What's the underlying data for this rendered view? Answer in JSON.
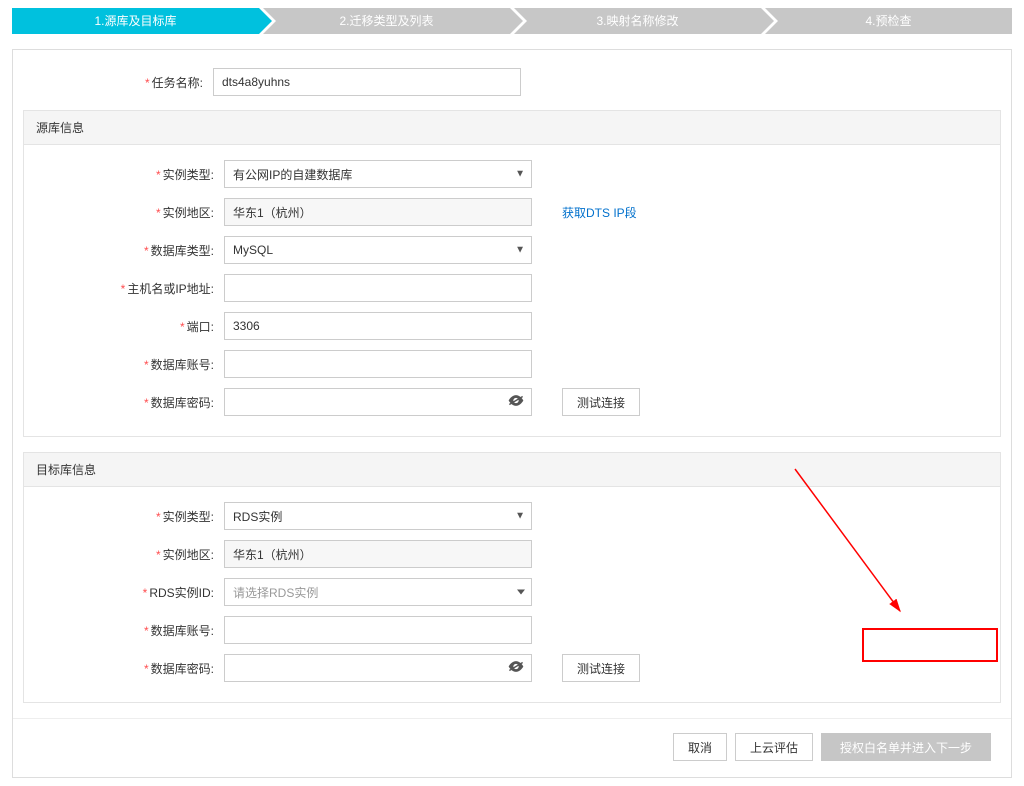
{
  "steps": {
    "s1": "1.源库及目标库",
    "s2": "2.迁移类型及列表",
    "s3": "3.映射名称修改",
    "s4": "4.预检查"
  },
  "task": {
    "label": "任务名称:",
    "value": "dts4a8yuhns"
  },
  "source": {
    "title": "源库信息",
    "instance_type": {
      "label": "实例类型:",
      "value": "有公网IP的自建数据库"
    },
    "region": {
      "label": "实例地区:",
      "value": "华东1（杭州）"
    },
    "db_type": {
      "label": "数据库类型:",
      "value": "MySQL"
    },
    "host": {
      "label": "主机名或IP地址:",
      "value": ""
    },
    "port": {
      "label": "端口:",
      "value": "3306"
    },
    "account": {
      "label": "数据库账号:",
      "value": ""
    },
    "password": {
      "label": "数据库密码:",
      "value": ""
    },
    "dts_ip_link": "获取DTS IP段",
    "test_btn": "测试连接"
  },
  "target": {
    "title": "目标库信息",
    "instance_type": {
      "label": "实例类型:",
      "value": "RDS实例"
    },
    "region": {
      "label": "实例地区:",
      "value": "华东1（杭州）"
    },
    "rds_id": {
      "label": "RDS实例ID:",
      "placeholder": "请选择RDS实例"
    },
    "account": {
      "label": "数据库账号:",
      "value": ""
    },
    "password": {
      "label": "数据库密码:",
      "value": ""
    },
    "test_btn": "测试连接"
  },
  "footer": {
    "cancel": "取消",
    "evaluate": "上云评估",
    "next": "授权白名单并进入下一步"
  }
}
